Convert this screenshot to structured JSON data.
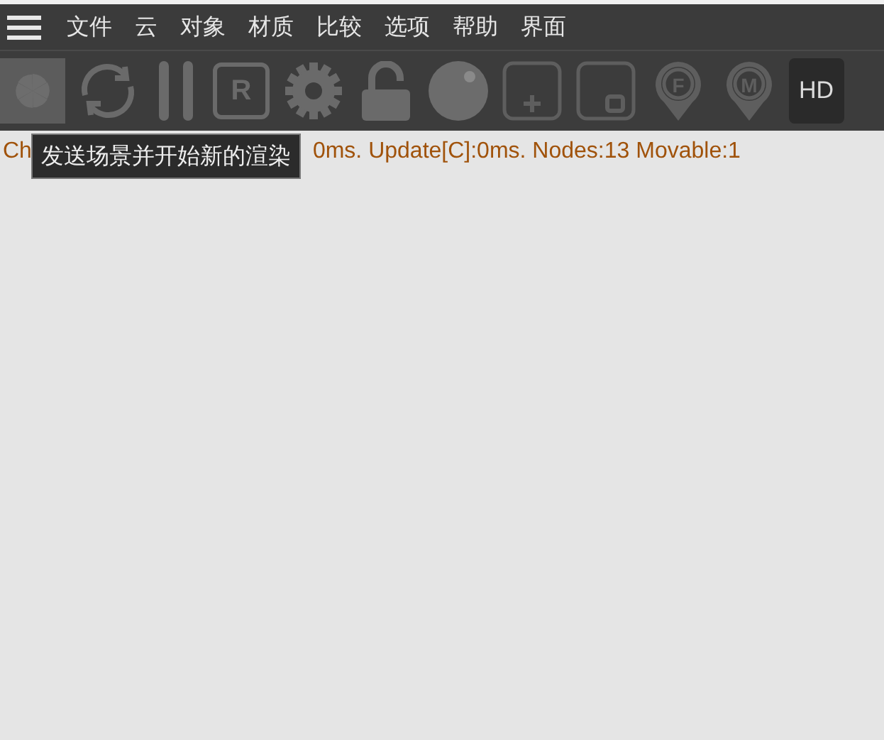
{
  "menu": {
    "items": [
      "文件",
      "云",
      "对象",
      "材质",
      "比较",
      "选项",
      "帮助",
      "界面"
    ]
  },
  "toolbar": {
    "items": [
      {
        "kind": "render",
        "selected": true
      },
      {
        "kind": "refresh",
        "selected": false
      },
      {
        "kind": "pause",
        "selected": false
      },
      {
        "kind": "letter-box",
        "label": "R",
        "selected": false
      },
      {
        "kind": "gear",
        "selected": false
      },
      {
        "kind": "lock",
        "selected": false
      },
      {
        "kind": "sphere",
        "selected": false
      },
      {
        "kind": "plus-box",
        "selected": false
      },
      {
        "kind": "square-box",
        "selected": false
      },
      {
        "kind": "pin",
        "label": "F",
        "selected": false
      },
      {
        "kind": "pin",
        "label": "M",
        "selected": false
      },
      {
        "kind": "text",
        "label": "HD",
        "selected": false
      }
    ]
  },
  "status": {
    "parts": [
      "Ch",
      "0ms. Update[C]:0ms. Nodes:13 Movable:1"
    ]
  },
  "tooltip": {
    "text": "发送场景并开始新的渲染"
  }
}
